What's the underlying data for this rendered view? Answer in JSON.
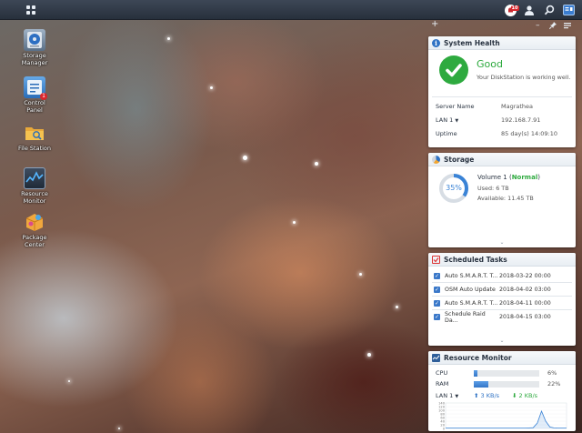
{
  "desktop": {
    "icons": [
      {
        "label": "Storage\nManager",
        "icon": "storage-manager-icon"
      },
      {
        "label": "Control Panel",
        "icon": "control-panel-icon",
        "badge": "1"
      },
      {
        "label": "File Station",
        "icon": "file-station-icon"
      },
      {
        "label": "Resource\nMonitor",
        "icon": "resource-monitor-icon"
      },
      {
        "label": "Package\nCenter",
        "icon": "package-center-icon"
      }
    ]
  },
  "taskbar": {
    "notification_count": "10"
  },
  "panel": {
    "add_symbol": "+",
    "minimize_symbol": "–",
    "pin_symbol": "📌"
  },
  "system_health": {
    "title": "System Health",
    "status": "Good",
    "message": "Your DiskStation is working well.",
    "server_name_label": "Server Name",
    "server_name": "Magrathea",
    "lan_label": "LAN 1",
    "lan_ip": "192.168.7.91",
    "uptime_label": "Uptime",
    "uptime": "85 day(s) 14:09:10",
    "status_color": "#2eaa3f"
  },
  "storage": {
    "title": "Storage",
    "volume": "Volume 1",
    "volume_status": "Normal",
    "percent_label": "35%",
    "percent": 35,
    "used_label": "Used:",
    "used": "6 TB",
    "available_label": "Available:",
    "available": "11.45 TB"
  },
  "scheduled_tasks": {
    "title": "Scheduled Tasks",
    "tasks": [
      {
        "name": "Auto S.M.A.R.T. T...",
        "date": "2018-03-22 00:00"
      },
      {
        "name": "OSM Auto Update",
        "date": "2018-04-02 03:00"
      },
      {
        "name": "Auto S.M.A.R.T. T...",
        "date": "2018-04-11 00:00"
      },
      {
        "name": "Schedule Raid Da...",
        "date": "2018-04-15 03:00"
      }
    ]
  },
  "resource_monitor": {
    "title": "Resource Monitor",
    "cpu_label": "CPU",
    "cpu_value": "6%",
    "cpu_percent": 6,
    "ram_label": "RAM",
    "ram_value": "22%",
    "ram_percent": 22,
    "lan_label": "LAN 1",
    "upload": "3 KB/s",
    "download": "2 KB/s",
    "y_ticks": [
      "140",
      "120",
      "100",
      "80",
      "60",
      "40",
      "20",
      "0"
    ],
    "network_series": [
      2,
      2,
      2,
      2,
      2,
      2,
      2,
      2,
      2,
      2,
      2,
      2,
      2,
      2,
      2,
      2,
      2,
      2,
      2,
      2,
      3,
      4,
      30,
      95,
      40,
      8,
      3,
      2,
      2,
      2
    ]
  }
}
